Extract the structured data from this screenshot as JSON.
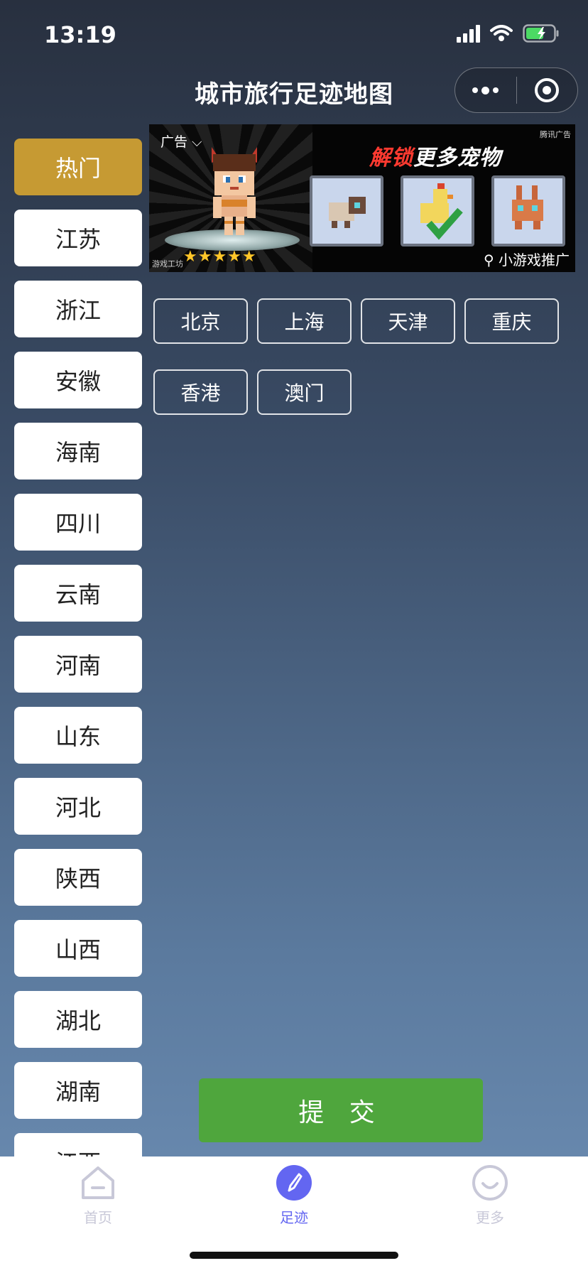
{
  "status_bar": {
    "time": "13:19"
  },
  "nav": {
    "title": "城市旅行足迹地图"
  },
  "sidebar": {
    "items": [
      {
        "label": "热门",
        "active": true
      },
      {
        "label": "江苏"
      },
      {
        "label": "浙江"
      },
      {
        "label": "安徽"
      },
      {
        "label": "海南"
      },
      {
        "label": "四川"
      },
      {
        "label": "云南"
      },
      {
        "label": "河南"
      },
      {
        "label": "山东"
      },
      {
        "label": "河北"
      },
      {
        "label": "陕西"
      },
      {
        "label": "山西"
      },
      {
        "label": "湖北"
      },
      {
        "label": "湖南"
      },
      {
        "label": "江西"
      }
    ]
  },
  "ad": {
    "label": "广告 ⌵",
    "brand": "腾讯广告",
    "headline_red": "解锁",
    "headline_white": "更多宠物",
    "promo": "小游戏推广",
    "studio": "游戏工坊"
  },
  "cities": {
    "rows": [
      [
        "北京",
        "上海",
        "天津",
        "重庆"
      ],
      [
        "香港",
        "澳门"
      ]
    ]
  },
  "submit_label": "提 交",
  "tabbar": {
    "items": [
      {
        "label": "首页",
        "icon": "home-icon",
        "active": false
      },
      {
        "label": "足迹",
        "icon": "compass-icon",
        "active": true
      },
      {
        "label": "更多",
        "icon": "smile-icon",
        "active": false
      }
    ]
  },
  "colors": {
    "active_sidebar": "#c69a33",
    "submit": "#4fa63d",
    "tab_active": "#6366f1",
    "tab_inactive": "#c8c8d8"
  }
}
